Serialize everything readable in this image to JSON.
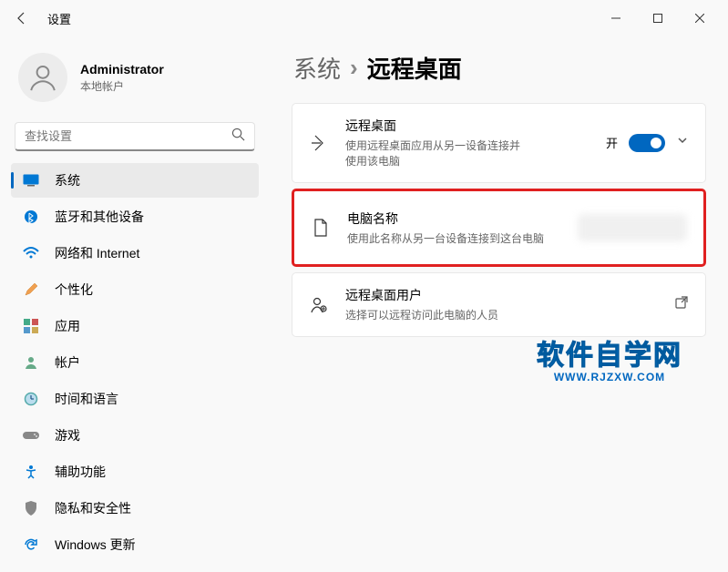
{
  "window": {
    "title": "设置"
  },
  "profile": {
    "name": "Administrator",
    "subtitle": "本地帐户"
  },
  "search": {
    "placeholder": "查找设置"
  },
  "sidebar": {
    "items": [
      {
        "label": "系统",
        "icon": "system"
      },
      {
        "label": "蓝牙和其他设备",
        "icon": "bluetooth"
      },
      {
        "label": "网络和 Internet",
        "icon": "network"
      },
      {
        "label": "个性化",
        "icon": "personalize"
      },
      {
        "label": "应用",
        "icon": "apps"
      },
      {
        "label": "帐户",
        "icon": "accounts"
      },
      {
        "label": "时间和语言",
        "icon": "time"
      },
      {
        "label": "游戏",
        "icon": "gaming"
      },
      {
        "label": "辅助功能",
        "icon": "accessibility"
      },
      {
        "label": "隐私和安全性",
        "icon": "privacy"
      },
      {
        "label": "Windows 更新",
        "icon": "update"
      }
    ]
  },
  "breadcrumb": {
    "parent": "系统",
    "current": "远程桌面"
  },
  "cards": {
    "remote": {
      "title": "远程桌面",
      "sub": "使用远程桌面应用从另一设备连接并使用该电脑",
      "toggle_label": "开"
    },
    "pcname": {
      "title": "电脑名称",
      "sub": "使用此名称从另一台设备连接到这台电脑"
    },
    "users": {
      "title": "远程桌面用户",
      "sub": "选择可以远程访问此电脑的人员"
    }
  },
  "watermark": {
    "main": "软件自学网",
    "sub": "WWW.RJZXW.COM"
  }
}
